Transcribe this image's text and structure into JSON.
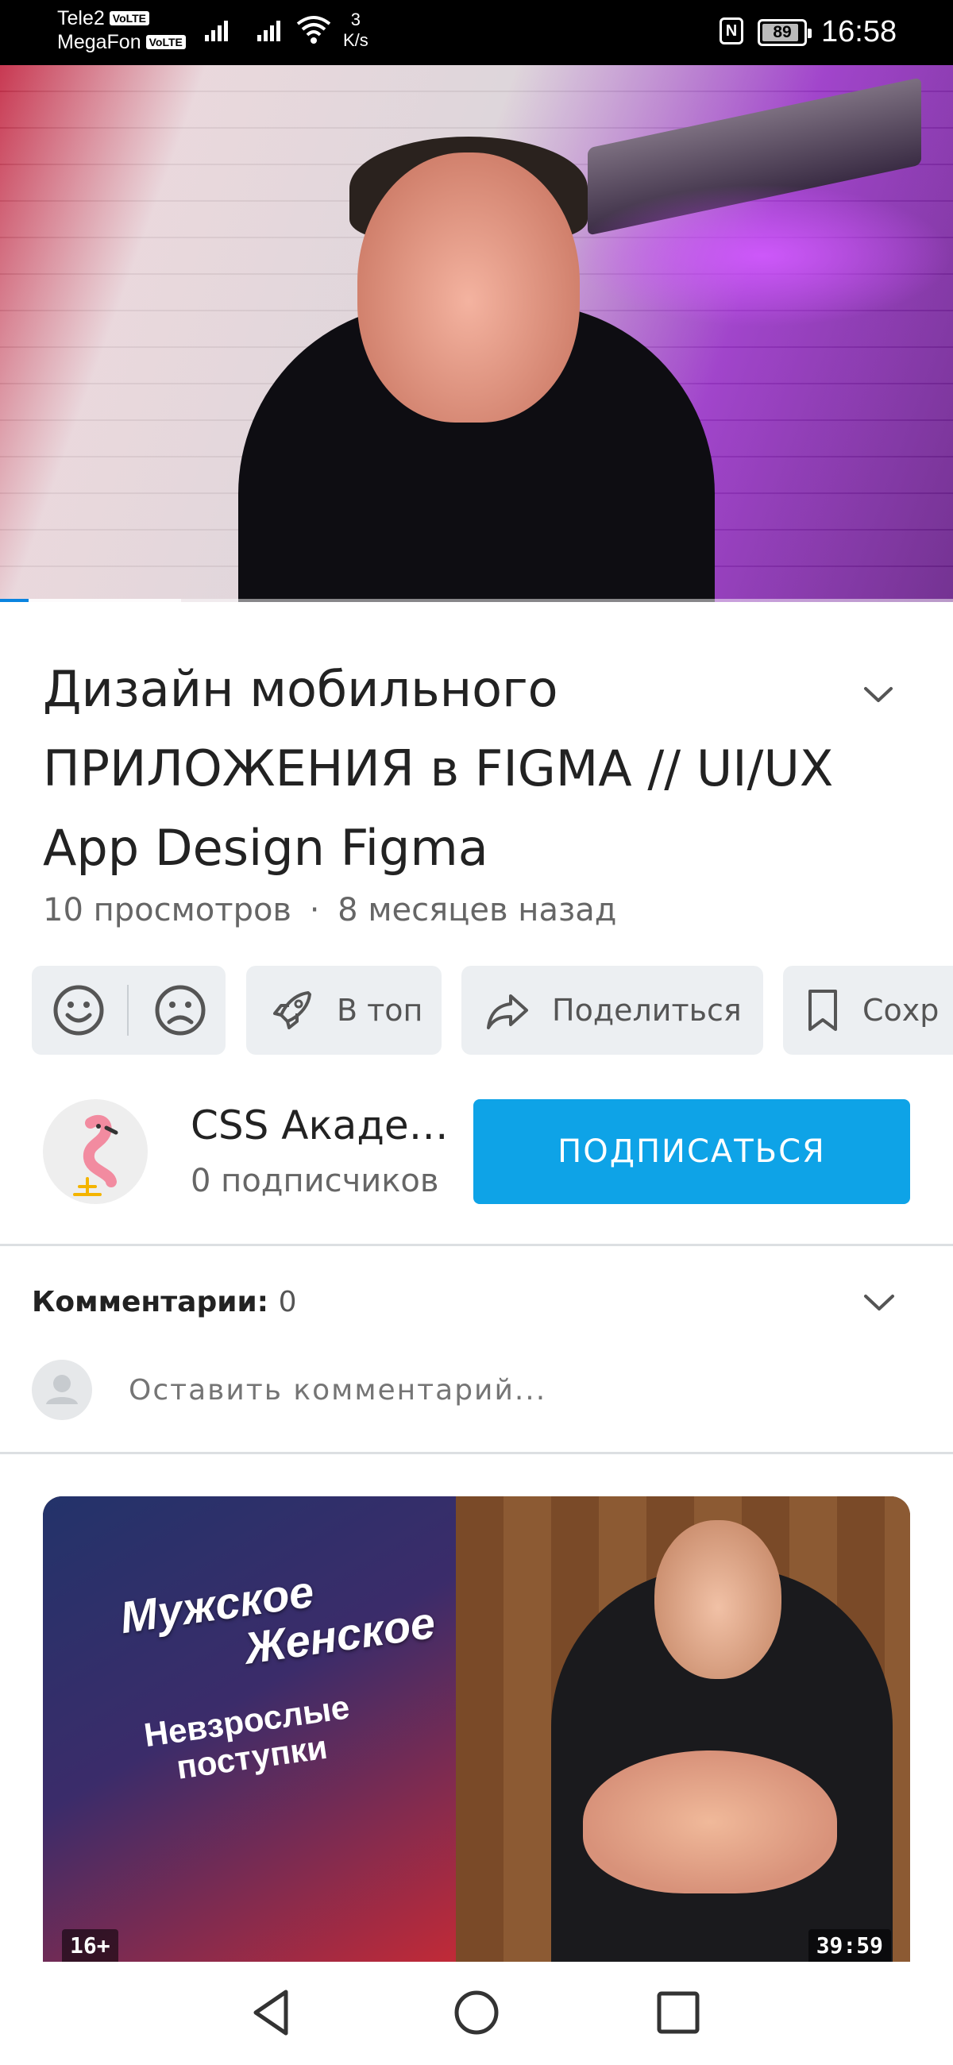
{
  "status_bar": {
    "carrier_1": "Tele2",
    "carrier_2": "MegaFon",
    "volte_label": "VoLTE",
    "net_speed_value": "3",
    "net_speed_unit": "K/s",
    "nfc_label": "N",
    "battery_percent": "89",
    "battery_level": 0.89,
    "time": "16:58"
  },
  "player": {
    "progress_played": 0.03,
    "progress_buffered": 0.19
  },
  "video": {
    "title": "Дизайн мобильного ПРИЛОЖЕНИЯ в FIGMA // UI/UX App Design Figma",
    "views": "10 просмотров",
    "separator": "·",
    "age": "8 месяцев назад"
  },
  "actions": {
    "like_icon": "smile-icon",
    "dislike_icon": "frown-icon",
    "top_label": "В топ",
    "share_label": "Поделиться",
    "save_label": "Сохр"
  },
  "channel": {
    "name": "CSS Академия",
    "subscribers": "0 подписчиков",
    "subscribe_label": "ПОДПИСАТЬСЯ"
  },
  "comments": {
    "header_label": "Комментарии:",
    "count": "0",
    "placeholder": "Оставить комментарий..."
  },
  "recommended": {
    "show_title_1": "Мужское",
    "show_title_2": "Женское",
    "show_subtitle": "Невзрослые поступки",
    "age_rating": "16+",
    "duration": "39:59"
  },
  "colors": {
    "accent": "#0ea3e7",
    "progress": "#0a84e0",
    "chip_bg": "#eceff2"
  }
}
